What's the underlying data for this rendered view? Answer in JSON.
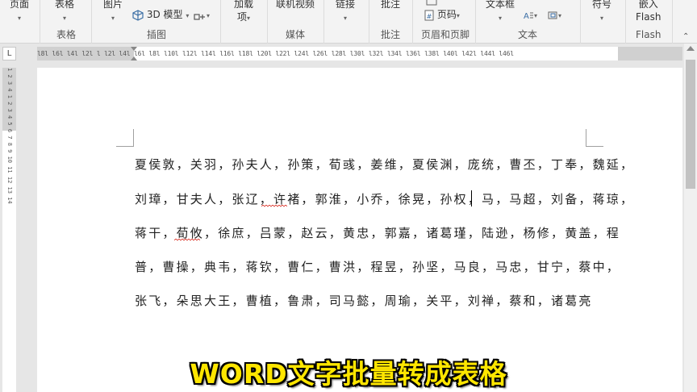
{
  "ribbon": {
    "page_btn": "页面",
    "table_btn": "表格",
    "table_group": "表格",
    "picture_btn": "图片",
    "model3d_btn": "3D 模型",
    "illustration_group": "插图",
    "addin_line1": "加载",
    "addin_line2": "项",
    "online_video_btn": "联机视频",
    "media_group": "媒体",
    "link_btn": "链接",
    "comment_btn": "批注",
    "comment_group": "批注",
    "page_number_btn": "页码",
    "header_footer_group": "页眉和页脚",
    "textbox_btn": "文本框",
    "text_group": "文本",
    "symbol_btn": "符号",
    "embed_line1": "嵌入",
    "embed_line2": "Flash",
    "flash_group": "Flash"
  },
  "ruler": {
    "corner": "L",
    "horizontal_ticks": "l8l l6l l4l l2l  l  l2l l4l l6l l8l l10l l12l l14l l16l l18l l20l l22l l24l l26l l28l l30l l32l l34l l36l l38l  l40l l42l l44l l46l",
    "vertical_ticks": "1 2 3 4  1 2 3 4 5 6 7 8 9 10 11 12 13 14"
  },
  "document": {
    "lines": [
      "夏侯敦，关羽，孙夫人，孙策，荀彧，姜维，夏侯渊，庞统，曹丕，丁奉，魏延，",
      "刘璋，甘夫人，张辽，许褚，郭淮，小乔，徐晃，孙权，马，马超，刘备，蒋琼，",
      "蒋干，荀攸，徐庶，吕蒙，赵云，黄忠，郭嘉，诸葛瑾，陆逊，杨修，黄盖，程",
      "普，曹操，典韦，蒋钦，曹仁，曹洪，程昱，孙坚，马良，马忠，甘宁，蔡中，",
      "张飞，朵思大王，曹植，鲁肃，司马懿，周瑜，关平，刘禅，蔡和，诸葛亮"
    ]
  },
  "caption": "WORD文字批量转成表格",
  "colors": {
    "caption_fill": "#ffe600",
    "caption_outline": "#000000",
    "squiggle": "#d93025"
  }
}
